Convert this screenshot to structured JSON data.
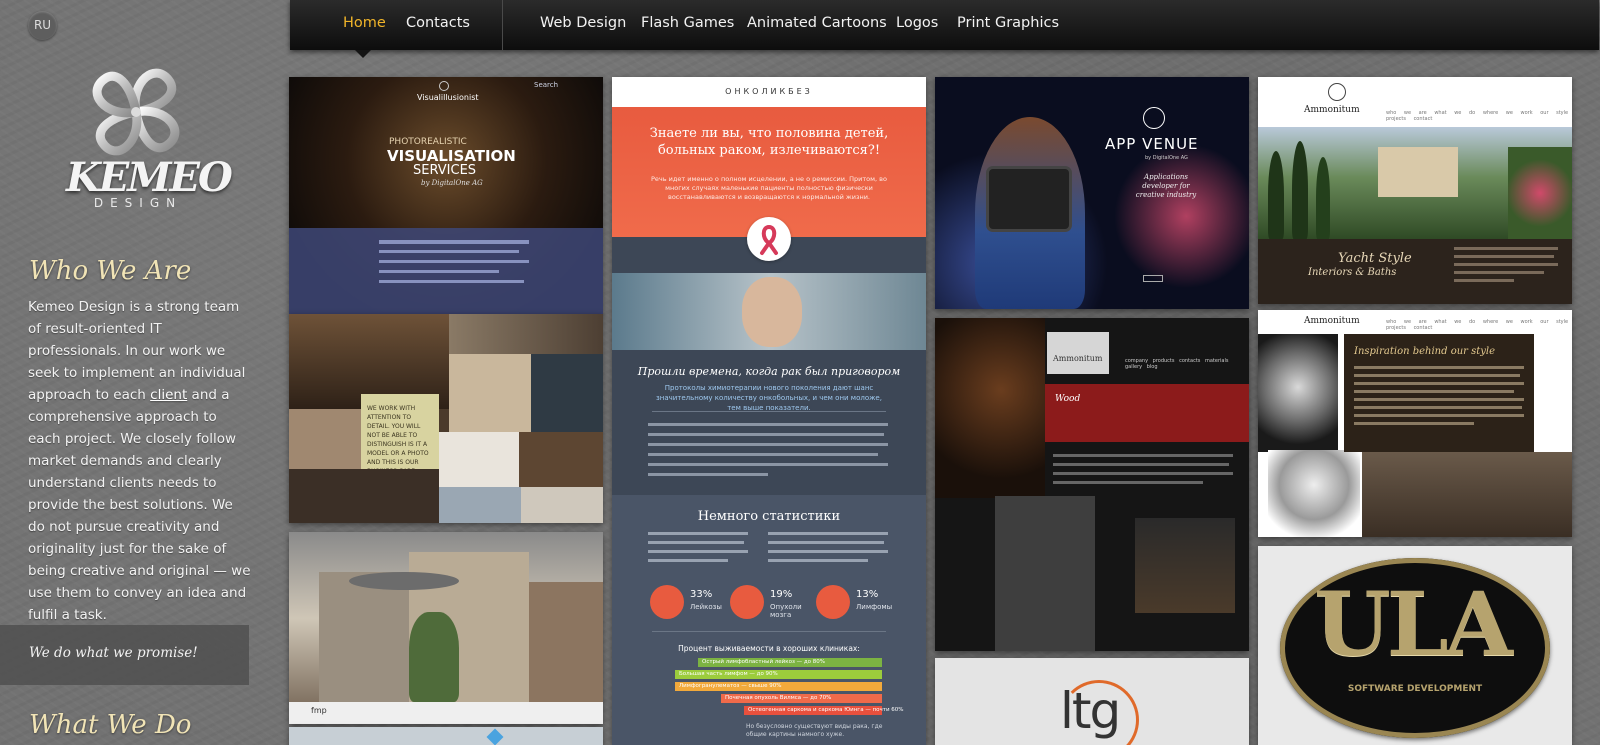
{
  "lang_switch": "RU",
  "logo": {
    "wordmark": "KEMEO",
    "subtitle": "DESIGN"
  },
  "nav": {
    "items": [
      {
        "label": "Home",
        "active": true
      },
      {
        "label": "Contacts",
        "active": false
      },
      {
        "label": "Web Design",
        "active": false
      },
      {
        "label": "Flash Games",
        "active": false
      },
      {
        "label": "Animated Cartoons",
        "active": false
      },
      {
        "label": "Logos",
        "active": false
      },
      {
        "label": "Print Graphics",
        "active": false
      }
    ]
  },
  "who_we_are": {
    "heading": "Who We Are",
    "text_before_link": "Kemeo Design is a strong team of result-oriented IT professionals. In our work we seek to implement an individual approach to each ",
    "link": "client",
    "text_after_link": " and a comprehensive approach to each project. We closely follow market demands and clearly understand clients needs to provide the best solutions. We do not pursue creativity and originality just for the sake of being creative and original — we use them to convey an idea and fulfil a task."
  },
  "motto": "We do what we promise!",
  "what_we_do": {
    "heading": "What We Do"
  },
  "portfolio": {
    "visualisation": {
      "brand": "Visualillusionist",
      "kicker": "PHOTOREALISTIC",
      "title": "VISUALISATION",
      "subtitle": "SERVICES",
      "byline": "by DigitalOne AG",
      "search": "Search"
    },
    "interiors": {
      "note": "WE WORK WITH ATTENTION TO DETAIL. YOU WILL NOT BE ABLE TO DISTINGUISH IS IT A MODEL OR A PHOTO AND THIS IS OUR BUSINESS CARD"
    },
    "collage": {
      "tag": "fmp"
    },
    "onko": {
      "brand": "ОНКОЛИКБЕЗ",
      "headline": "Знаете ли вы, что половина детей, больных раком, излечиваются?!",
      "lead": "Речь идет именно о полном исцелении, а не о ремиссии. Притом, во многих случаях маленькие пациенты полностью физически восстанавливаются и возвращаются к нормальной жизни.",
      "quote": "Прошли времена, когда рак был приговором",
      "quote_sub": "Протоколы химиотерапии нового поколения дают шанс значительному количеству онкобольных, и чем они моложе, тем выше показатели.",
      "stats_title": "Немного статистики",
      "stats": [
        {
          "value": "33%",
          "label": "Лейкозы"
        },
        {
          "value": "19%",
          "label": "Опухоли мозга"
        },
        {
          "value": "13%",
          "label": "Лимфомы"
        }
      ],
      "survival_title": "Процент выживаемости в хороших клиниках:",
      "bars": [
        {
          "label": "Острый лимфобластный лейкоз — до 80%",
          "color": "#7cb342",
          "value": 80
        },
        {
          "label": "Большая часть лимфом — до 90%",
          "color": "#9ccc3c",
          "value": 90
        },
        {
          "label": "Лимфогранулематоз — свыше 90%",
          "color": "#f2a93b",
          "value": 90
        },
        {
          "label": "Почечная опухоль Вилмса — до 70%",
          "color": "#f06a4a",
          "value": 70
        },
        {
          "label": "Остеогенная саркома и саркома Юинга — почти 60%",
          "color": "#e8503d",
          "value": 60
        }
      ],
      "footer": "Но безусловно существуют виды рака, где общие картины намного хуже."
    },
    "appvenue": {
      "title": "APP VENUE",
      "byline": "by DigitalOne AG",
      "tagline": "Applications developer for creative industry"
    },
    "ammonitum_dark": {
      "brand": "Ammonitum",
      "menu": [
        "company",
        "products",
        "contacts",
        "materials",
        "gallery",
        "blog"
      ],
      "panel_title": "Wood"
    },
    "ltg": {
      "logo": "ltg"
    },
    "ammonitum_yacht": {
      "brand": "Ammonitum",
      "menu": [
        "who we are",
        "what we do",
        "where we work",
        "our style",
        "projects",
        "contact"
      ],
      "script_line1": "Yacht Style",
      "script_line2": "Interiors & Baths"
    },
    "ammonitum_style": {
      "brand": "Ammonitum",
      "menu": [
        "who we are",
        "what we do",
        "where we work",
        "our style",
        "projects",
        "contact"
      ],
      "script_title": "Inspiration behind our style"
    },
    "ula": {
      "logo": "ULA",
      "tagline": "SOFTWARE DEVELOPMENT"
    }
  }
}
